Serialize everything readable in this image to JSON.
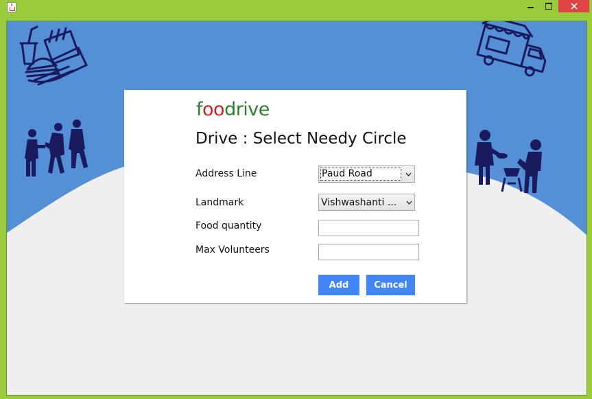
{
  "window": {
    "controls": [
      "minimize-icon",
      "maximize-icon",
      "close-icon"
    ]
  },
  "colors": {
    "frame": "#99cc3a",
    "hero_blue": "#558fd6",
    "background": "#efefef",
    "illustration": "#1a1a5e",
    "button": "#4285f4",
    "logo_green": "#2e7d32",
    "logo_red": "#c62828"
  },
  "illustrations": [
    "food-combo-icon",
    "food-truck-icon",
    "people-sharing-icon",
    "person-serving-icon"
  ],
  "dialog": {
    "logo": {
      "part1": "f",
      "part2": "oo",
      "part3": "drive"
    },
    "title": "Drive : Select Needy Circle",
    "address_label": "Address Line",
    "address_value": "Paud Road",
    "landmark_label": "Landmark",
    "landmark_value": "Vishwashanti ...",
    "food_label": "Food quantity",
    "food_value": "",
    "volunteers_label": "Max Volunteers",
    "volunteers_value": "",
    "add_label": "Add",
    "cancel_label": "Cancel"
  }
}
